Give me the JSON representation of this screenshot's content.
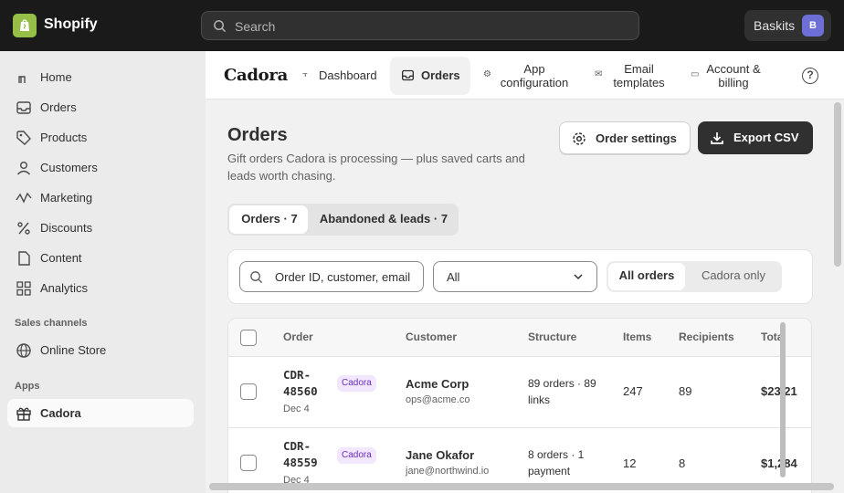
{
  "topbar": {
    "brand": "Shopify",
    "search_placeholder": "Search",
    "store_name": "Baskits",
    "avatar_initial": "B"
  },
  "sidebar": {
    "items": [
      {
        "label": "Home",
        "icon": "home-icon"
      },
      {
        "label": "Orders",
        "icon": "inbox-icon"
      },
      {
        "label": "Products",
        "icon": "tag-icon"
      },
      {
        "label": "Customers",
        "icon": "person-icon"
      },
      {
        "label": "Marketing",
        "icon": "target-icon"
      },
      {
        "label": "Discounts",
        "icon": "discount-icon"
      },
      {
        "label": "Content",
        "icon": "document-icon"
      },
      {
        "label": "Analytics",
        "icon": "chart-icon"
      }
    ],
    "sales_channels_title": "Sales channels",
    "online_store": "Online Store",
    "apps_title": "Apps",
    "app_active": "Cadora"
  },
  "appbar": {
    "app_name": "Cadora",
    "tabs": [
      {
        "label": "Dashboard"
      },
      {
        "label": "Orders"
      },
      {
        "label": "App configuration"
      },
      {
        "label": "Email templates"
      },
      {
        "label": "Account & billing"
      }
    ],
    "help": "?"
  },
  "page": {
    "title": "Orders",
    "subtitle": "Gift orders Cadora is processing — plus saved carts and leads worth chasing.",
    "settings_button": "Order settings",
    "export_button": "Export CSV",
    "tabs": [
      {
        "label": "Orders · 7"
      },
      {
        "label": "Abandoned & leads · 7"
      }
    ]
  },
  "filters": {
    "search_placeholder": "Order ID, customer, email",
    "select_value": "All",
    "scope_options": [
      {
        "label": "All orders"
      },
      {
        "label": "Cadora only"
      }
    ]
  },
  "table": {
    "columns": [
      "Order",
      "Customer",
      "Structure",
      "Items",
      "Recipients",
      "Total"
    ],
    "rows": [
      {
        "order_id": "CDR-48560",
        "date": "Dec 4",
        "badge": "Cadora",
        "customer": "Acme Corp",
        "email": "ops@acme.co",
        "structure": "89 orders · 89 links",
        "items": "247",
        "recipients": "89",
        "total": "$23,21"
      },
      {
        "order_id": "CDR-48559",
        "date": "Dec 4",
        "badge": "Cadora",
        "customer": "Jane Okafor",
        "email": "jane@northwind.io",
        "structure": "8 orders · 1 payment",
        "items": "12",
        "recipients": "8",
        "total": "$1,284"
      }
    ]
  }
}
